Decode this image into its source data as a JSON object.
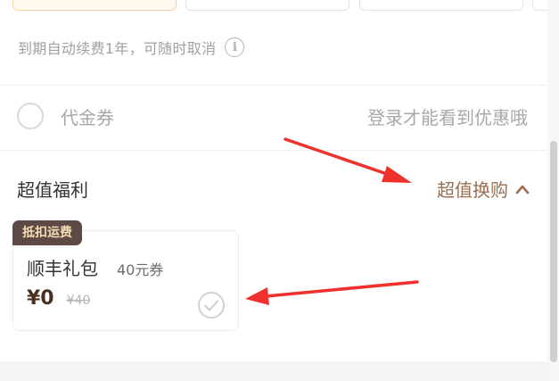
{
  "renewal": {
    "text": "到期自动续费1年，可随时取消",
    "info_icon": "info-icon"
  },
  "voucher": {
    "label": "代金券",
    "hint": "登录才能看到优惠哦"
  },
  "benefits": {
    "title": "超值福利",
    "link_label": "超值换购",
    "link_icon": "chevron-up-icon"
  },
  "product": {
    "badge": "抵扣运费",
    "name": "顺丰礼包",
    "note": "40元券",
    "price": "¥0",
    "original_price": "¥40",
    "check_icon": "check-circle-icon"
  },
  "colors": {
    "accent_brown": "#9a6f52",
    "badge_bg": "#5d4a44",
    "badge_text": "#f6dcb6",
    "annotation_arrow": "#f0302d"
  }
}
